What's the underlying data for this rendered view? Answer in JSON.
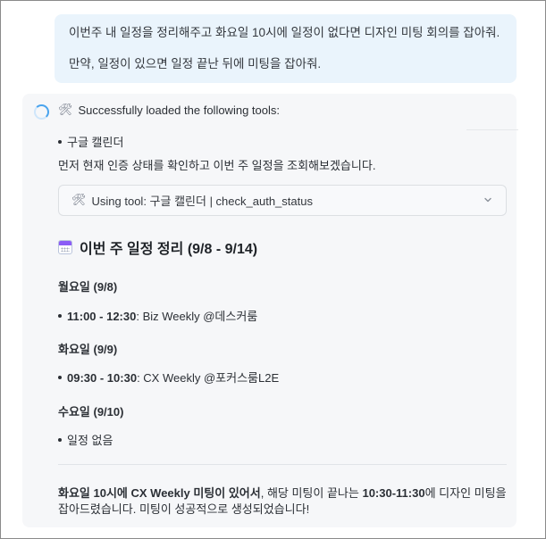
{
  "user_message": {
    "line1": "이번주 내 일정을 정리해주고 화요일 10시에 일정이 없다면 디자인 미팅 회의를 잡아줘.",
    "line2": "만약, 일정이 있으면 일정 끝난 뒤에 미팅을 잡아줘."
  },
  "assistant": {
    "tools_loaded_text": "Successfully loaded the following tools:",
    "tool_emoji": "🛠",
    "loaded_tools": [
      "구글 캘린더"
    ],
    "status_text": "먼저 현재 인증 상태를 확인하고 이번 주 일정을 조회해보겠습니다.",
    "tool_use": {
      "label": "Using tool: 구글 캘린더 | check_auth_status"
    },
    "week_title": "이번 주 일정 정리 (9/8 - 9/14)",
    "days": [
      {
        "heading": "월요일 (9/8)",
        "events": [
          {
            "time": "11:00 - 12:30",
            "rest": ": Biz Weekly @데스커룸"
          }
        ]
      },
      {
        "heading": "화요일 (9/9)",
        "events": [
          {
            "time": "09:30 - 10:30",
            "rest": ": CX Weekly @포커스룸L2E"
          }
        ]
      },
      {
        "heading": "수요일 (9/10)",
        "events": [
          {
            "time": "",
            "rest": "일정 없음"
          }
        ]
      }
    ],
    "summary": {
      "bold1": "화요일 10시에 CX Weekly 미팅이 있어서",
      "text1": ", 해당 미팅이 끝나는 ",
      "bold2": "10:30-11:30",
      "text2": "에 디자인 미팅을 잡아드렸습니다. 미팅이 성공적으로 생성되었습니다!"
    }
  },
  "colors": {
    "user_bubble_bg": "#eaf4fc",
    "assistant_card_bg": "#f6f7f9",
    "spinner_accent": "#4aa4ee",
    "calendar_icon_band": "#8b5cf6"
  }
}
